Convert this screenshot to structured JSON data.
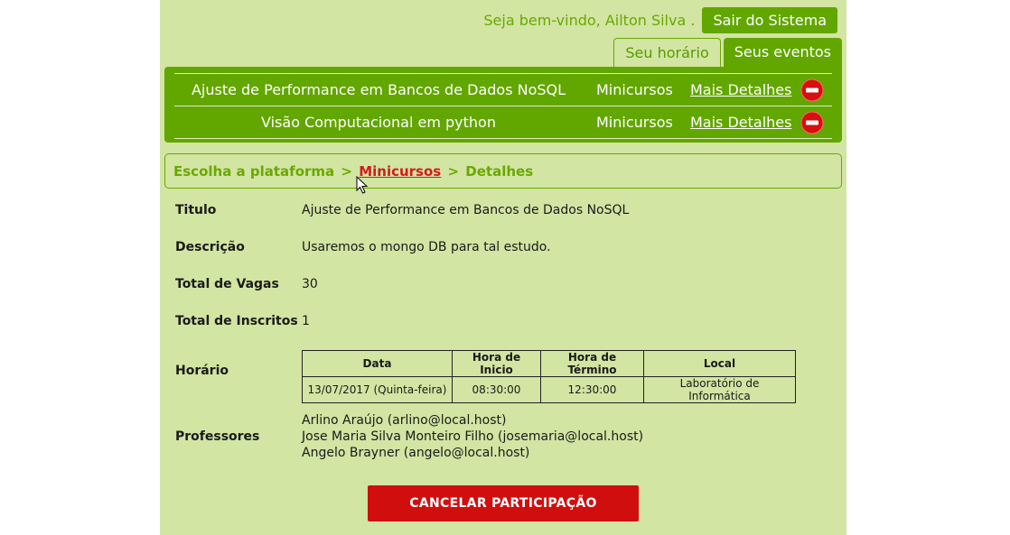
{
  "header": {
    "welcome_text": "Seja bem-vindo, Ailton Silva .",
    "logout_label": "Sair do Sistema"
  },
  "tabs": [
    {
      "label": "Seu horário",
      "active": false
    },
    {
      "label": "Seus eventos",
      "active": true
    }
  ],
  "events": [
    {
      "title": "Ajuste de Performance em Bancos de Dados NoSQL",
      "type": "Minicursos",
      "details_label": "Mais Detalhes",
      "remove_icon": "remove-circle-icon"
    },
    {
      "title": "Visão Computacional em python",
      "type": "Minicursos",
      "details_label": "Mais Detalhes",
      "remove_icon": "remove-circle-icon"
    }
  ],
  "breadcrumb": {
    "step1": "Escolha a plataforma",
    "separator": ">",
    "step2": "Minicursos",
    "step3": "Detalhes"
  },
  "details": {
    "titulo_label": "Titulo",
    "titulo_value": "Ajuste de Performance em Bancos de Dados NoSQL",
    "descricao_label": "Descrição",
    "descricao_value": "Usaremos o mongo DB para tal estudo.",
    "vagas_label": "Total de Vagas",
    "vagas_value": "30",
    "inscritos_label": "Total de Inscritos",
    "inscritos_value": "1",
    "horario_label": "Horário",
    "professores_label": "Professores"
  },
  "schedule": {
    "headers": [
      "Data",
      "Hora de Inicio",
      "Hora de Término",
      "Local"
    ],
    "rows": [
      [
        "13/07/2017 (Quinta-feira)",
        "08:30:00",
        "12:30:00",
        "Laboratório de Informática"
      ]
    ]
  },
  "professors": [
    "Arlino Araújo (arlino@local.host)",
    "Jose Maria Silva Monteiro Filho (josemaria@local.host)",
    "Angelo Brayner (angelo@local.host)"
  ],
  "cancel_label": "CANCELAR PARTICIPAÇÃO",
  "colors": {
    "brand_green": "#62a600",
    "page_bg": "#d2e5a3",
    "danger_red": "#d10e0e"
  }
}
